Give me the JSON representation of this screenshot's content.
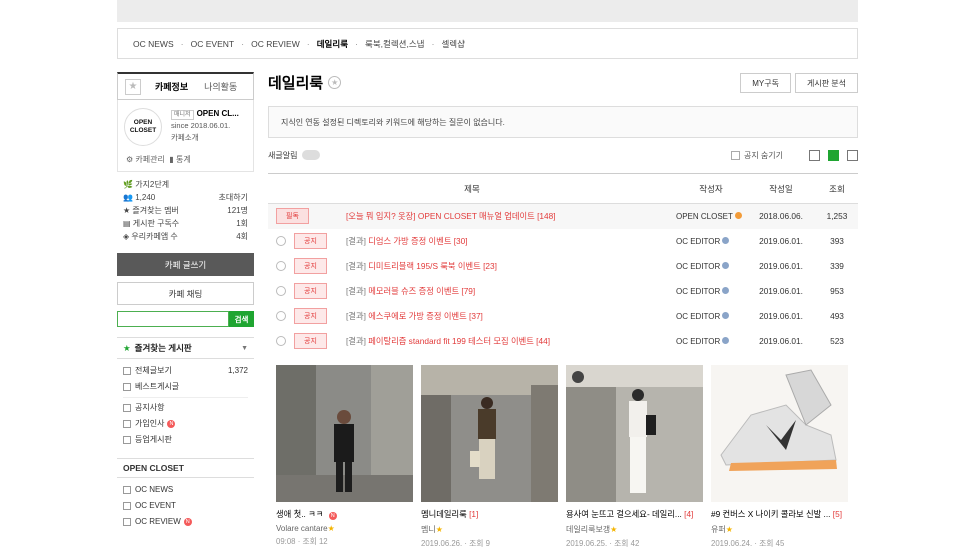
{
  "topnav": [
    "OC NEWS",
    "OC EVENT",
    "OC REVIEW",
    "데일리룩",
    "룩북,컬렉션,스냅",
    "셀렉샵"
  ],
  "side": {
    "tab_info": "카페정보",
    "tab_my": "나의활동",
    "logo_top": "OPEN",
    "logo_bot": "CLOSET",
    "mgr_badge": "매니저",
    "name": "OPEN CL...",
    "since": "since 2018.06.01.",
    "intro": "카페소개",
    "manage": "카페관리",
    "stats_link": "통계",
    "level": "가지2단계",
    "members": "1,240",
    "invite": "초대하기",
    "rows": [
      {
        "k": "즐겨찾는 멤버",
        "v": "121명"
      },
      {
        "k": "게시판 구독수",
        "v": "1회"
      },
      {
        "k": "우리카페앱 수",
        "v": "4회"
      }
    ],
    "write": "카페 글쓰기",
    "chat": "카페 채팅",
    "search_btn": "검색",
    "fav_title": "즐겨찾는 게시판",
    "menu1": [
      {
        "t": "전체글보기",
        "c": "1,372"
      },
      {
        "t": "베스트게시글",
        "c": ""
      }
    ],
    "menu2": [
      {
        "t": "공지사항",
        "c": ""
      },
      {
        "t": "가입인사",
        "c": ""
      },
      {
        "t": "등업게시판",
        "c": ""
      }
    ],
    "group": "OPEN CLOSET",
    "menu3": [
      "OC NEWS",
      "OC EVENT",
      "OC REVIEW"
    ]
  },
  "main": {
    "title": "데일리룩",
    "btn_sub": "MY구독",
    "btn_ana": "게시판 분석",
    "notice": "지식인 연동 설정된 디렉토리와 키워드에 해당하는 질문이 없습니다.",
    "alarm": "새글알림",
    "hide": "공지 숨기기",
    "head": {
      "title": "제목",
      "author": "작성자",
      "date": "작성일",
      "views": "조회"
    },
    "rows": [
      {
        "badge": "필독",
        "prefix": "",
        "title": "[오늘 뭐 입지? 옷장] OPEN CLOSET 매뉴얼 업데이트 [148]",
        "author": "OPEN CLOSET",
        "date": "2018.06.06.",
        "views": "1,253",
        "pin": true
      },
      {
        "badge": "공지",
        "prefix": "[결과]",
        "title": "디엄스 가방 증정 이벤트 [30]",
        "author": "OC EDITOR",
        "date": "2019.06.01.",
        "views": "393"
      },
      {
        "badge": "공지",
        "prefix": "[결과]",
        "title": "디미트리블랙 195/S 룩북 이벤트 [23]",
        "author": "OC EDITOR",
        "date": "2019.06.01.",
        "views": "339"
      },
      {
        "badge": "공지",
        "prefix": "[결과]",
        "title": "메모러블 슈즈 증정 이벤트 [79]",
        "author": "OC EDITOR",
        "date": "2019.06.01.",
        "views": "953"
      },
      {
        "badge": "공지",
        "prefix": "[결과]",
        "title": "에스쿠에로 가방 증정 이벤트 [37]",
        "author": "OC EDITOR",
        "date": "2019.06.01.",
        "views": "493"
      },
      {
        "badge": "공지",
        "prefix": "[결과]",
        "title": "페이탈리즘 standard fit 199 테스터 모집 이벤트 [44]",
        "author": "OC EDITOR",
        "date": "2019.06.01.",
        "views": "523"
      }
    ],
    "cards": [
      {
        "title": "생애 첫.. ㅋㅋ",
        "n": "",
        "author": "Volare cantare",
        "date": "09:08",
        "views": "· 조회 12"
      },
      {
        "title": "멤니데일리룩",
        "n": "[1]",
        "author": "멤니",
        "date": "2019.06.26.",
        "views": "· 조회 9"
      },
      {
        "title": "용사여 눈뜨고 걸으세요- 데일리...",
        "n": "[4]",
        "author": "데일리룩보갱",
        "date": "2019.06.25.",
        "views": "· 조회 42"
      },
      {
        "title": "#9 컨버스 X 나이키 콜라보 신발 ...",
        "n": "[5]",
        "author": "유퍼",
        "date": "2019.06.24.",
        "views": "· 조회 45"
      }
    ]
  }
}
